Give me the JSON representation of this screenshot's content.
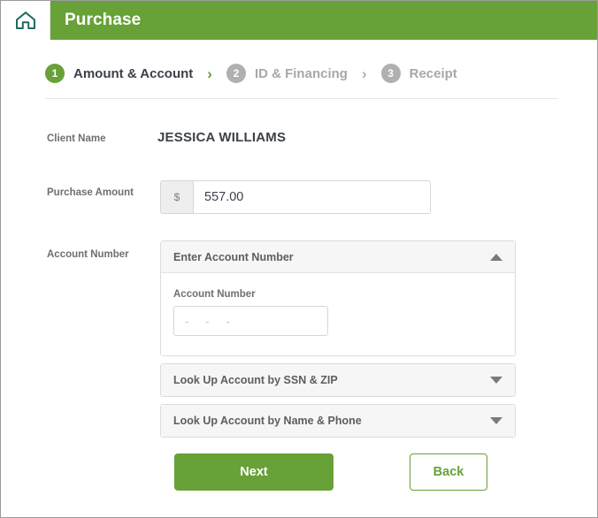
{
  "window": {
    "home_icon": "home-icon",
    "title": "Purchase",
    "header_color": "#67a137"
  },
  "stepper": {
    "separator": "›",
    "steps": [
      {
        "number": "1",
        "label": "Amount & Account",
        "state": "active"
      },
      {
        "number": "2",
        "label": "ID & Financing",
        "state": "inactive"
      },
      {
        "number": "3",
        "label": "Receipt",
        "state": "inactive"
      }
    ]
  },
  "form": {
    "client_name": {
      "label": "Client Name",
      "value": "JESSICA WILLIAMS"
    },
    "purchase_amount": {
      "label": "Purchase Amount",
      "currency_symbol": "$",
      "value": "557.00",
      "placeholder": ""
    },
    "account_number": {
      "label": "Account Number",
      "panels": [
        {
          "title": "Enter Account Number",
          "expanded": true,
          "caret_icon": "chevron-up-icon",
          "inner_label": "Account Number",
          "input_value": "",
          "input_placeholder": "-   -   -"
        },
        {
          "title": "Look Up Account by SSN & ZIP",
          "expanded": false,
          "caret_icon": "chevron-down-icon"
        },
        {
          "title": "Look Up Account by Name & Phone",
          "expanded": false,
          "caret_icon": "chevron-down-icon"
        }
      ]
    }
  },
  "actions": {
    "next_label": "Next",
    "back_label": "Back",
    "primary_color": "#67a137"
  }
}
